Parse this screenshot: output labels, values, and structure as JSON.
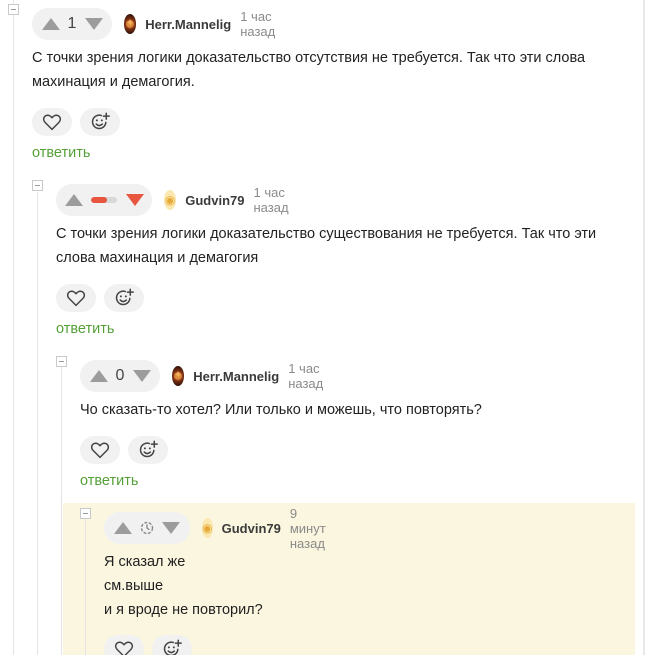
{
  "comments": [
    {
      "rating": "1",
      "rating_state": "number",
      "username": "Herr.Mannelig",
      "time": "1 час назад",
      "text": "С точки зрения логики доказательство отсутствия не требуется. Так что эти слова махинация и демагогия.",
      "reply_label": "ответить",
      "avatar_icon": "avatar-dark"
    },
    {
      "rating_state": "bar",
      "rating_negative_fraction": 0.6,
      "username": "Gudvin79",
      "time": "1 час назад",
      "text": "С точки зрения логики доказательство существования не требуется. Так что эти слова махинация и демагогия",
      "reply_label": "ответить",
      "avatar_icon": "avatar-light"
    },
    {
      "rating": "0",
      "rating_state": "number",
      "username": "Herr.Mannelig",
      "time": "1 час назад",
      "text": "Чо сказать-то хотел? Или только и можешь, что повторять?",
      "reply_label": "ответить",
      "avatar_icon": "avatar-dark"
    },
    {
      "rating_state": "pending",
      "username": "Gudvin79",
      "time": "9 минут назад",
      "text": "Я сказал же\nсм.выше\nи я вроде не повторил?",
      "avatar_icon": "avatar-light"
    }
  ],
  "colors": {
    "reply_link": "#549f37",
    "downvote_active": "#e8563f",
    "highlight_bg": "#fbf6df",
    "rating_bg": "#f1f1f1"
  },
  "icons": [
    "heart-icon",
    "smile-plus-icon",
    "arrow-up-icon",
    "arrow-down-icon",
    "clock-icon",
    "collapse-icon"
  ]
}
